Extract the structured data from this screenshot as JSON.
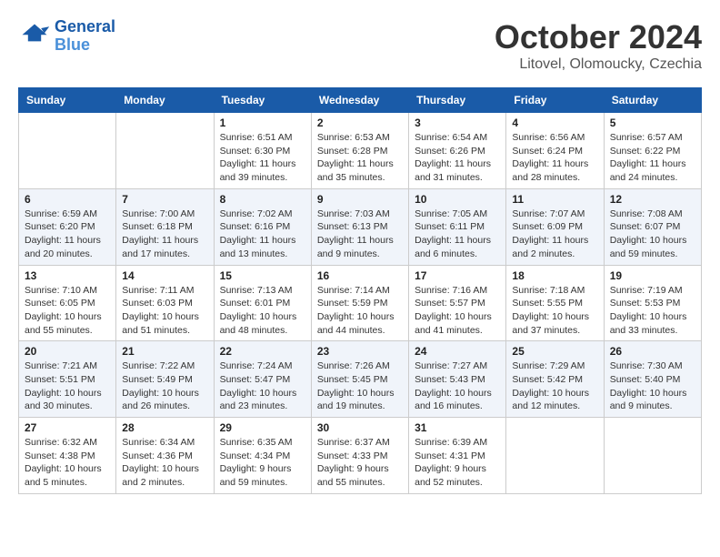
{
  "header": {
    "logo_line1": "General",
    "logo_line2": "Blue",
    "month_title": "October 2024",
    "subtitle": "Litovel, Olomoucky, Czechia"
  },
  "weekdays": [
    "Sunday",
    "Monday",
    "Tuesday",
    "Wednesday",
    "Thursday",
    "Friday",
    "Saturday"
  ],
  "weeks": [
    [
      {
        "day": "",
        "sunrise": "",
        "sunset": "",
        "daylight": ""
      },
      {
        "day": "",
        "sunrise": "",
        "sunset": "",
        "daylight": ""
      },
      {
        "day": "1",
        "sunrise": "Sunrise: 6:51 AM",
        "sunset": "Sunset: 6:30 PM",
        "daylight": "Daylight: 11 hours and 39 minutes."
      },
      {
        "day": "2",
        "sunrise": "Sunrise: 6:53 AM",
        "sunset": "Sunset: 6:28 PM",
        "daylight": "Daylight: 11 hours and 35 minutes."
      },
      {
        "day": "3",
        "sunrise": "Sunrise: 6:54 AM",
        "sunset": "Sunset: 6:26 PM",
        "daylight": "Daylight: 11 hours and 31 minutes."
      },
      {
        "day": "4",
        "sunrise": "Sunrise: 6:56 AM",
        "sunset": "Sunset: 6:24 PM",
        "daylight": "Daylight: 11 hours and 28 minutes."
      },
      {
        "day": "5",
        "sunrise": "Sunrise: 6:57 AM",
        "sunset": "Sunset: 6:22 PM",
        "daylight": "Daylight: 11 hours and 24 minutes."
      }
    ],
    [
      {
        "day": "6",
        "sunrise": "Sunrise: 6:59 AM",
        "sunset": "Sunset: 6:20 PM",
        "daylight": "Daylight: 11 hours and 20 minutes."
      },
      {
        "day": "7",
        "sunrise": "Sunrise: 7:00 AM",
        "sunset": "Sunset: 6:18 PM",
        "daylight": "Daylight: 11 hours and 17 minutes."
      },
      {
        "day": "8",
        "sunrise": "Sunrise: 7:02 AM",
        "sunset": "Sunset: 6:16 PM",
        "daylight": "Daylight: 11 hours and 13 minutes."
      },
      {
        "day": "9",
        "sunrise": "Sunrise: 7:03 AM",
        "sunset": "Sunset: 6:13 PM",
        "daylight": "Daylight: 11 hours and 9 minutes."
      },
      {
        "day": "10",
        "sunrise": "Sunrise: 7:05 AM",
        "sunset": "Sunset: 6:11 PM",
        "daylight": "Daylight: 11 hours and 6 minutes."
      },
      {
        "day": "11",
        "sunrise": "Sunrise: 7:07 AM",
        "sunset": "Sunset: 6:09 PM",
        "daylight": "Daylight: 11 hours and 2 minutes."
      },
      {
        "day": "12",
        "sunrise": "Sunrise: 7:08 AM",
        "sunset": "Sunset: 6:07 PM",
        "daylight": "Daylight: 10 hours and 59 minutes."
      }
    ],
    [
      {
        "day": "13",
        "sunrise": "Sunrise: 7:10 AM",
        "sunset": "Sunset: 6:05 PM",
        "daylight": "Daylight: 10 hours and 55 minutes."
      },
      {
        "day": "14",
        "sunrise": "Sunrise: 7:11 AM",
        "sunset": "Sunset: 6:03 PM",
        "daylight": "Daylight: 10 hours and 51 minutes."
      },
      {
        "day": "15",
        "sunrise": "Sunrise: 7:13 AM",
        "sunset": "Sunset: 6:01 PM",
        "daylight": "Daylight: 10 hours and 48 minutes."
      },
      {
        "day": "16",
        "sunrise": "Sunrise: 7:14 AM",
        "sunset": "Sunset: 5:59 PM",
        "daylight": "Daylight: 10 hours and 44 minutes."
      },
      {
        "day": "17",
        "sunrise": "Sunrise: 7:16 AM",
        "sunset": "Sunset: 5:57 PM",
        "daylight": "Daylight: 10 hours and 41 minutes."
      },
      {
        "day": "18",
        "sunrise": "Sunrise: 7:18 AM",
        "sunset": "Sunset: 5:55 PM",
        "daylight": "Daylight: 10 hours and 37 minutes."
      },
      {
        "day": "19",
        "sunrise": "Sunrise: 7:19 AM",
        "sunset": "Sunset: 5:53 PM",
        "daylight": "Daylight: 10 hours and 33 minutes."
      }
    ],
    [
      {
        "day": "20",
        "sunrise": "Sunrise: 7:21 AM",
        "sunset": "Sunset: 5:51 PM",
        "daylight": "Daylight: 10 hours and 30 minutes."
      },
      {
        "day": "21",
        "sunrise": "Sunrise: 7:22 AM",
        "sunset": "Sunset: 5:49 PM",
        "daylight": "Daylight: 10 hours and 26 minutes."
      },
      {
        "day": "22",
        "sunrise": "Sunrise: 7:24 AM",
        "sunset": "Sunset: 5:47 PM",
        "daylight": "Daylight: 10 hours and 23 minutes."
      },
      {
        "day": "23",
        "sunrise": "Sunrise: 7:26 AM",
        "sunset": "Sunset: 5:45 PM",
        "daylight": "Daylight: 10 hours and 19 minutes."
      },
      {
        "day": "24",
        "sunrise": "Sunrise: 7:27 AM",
        "sunset": "Sunset: 5:43 PM",
        "daylight": "Daylight: 10 hours and 16 minutes."
      },
      {
        "day": "25",
        "sunrise": "Sunrise: 7:29 AM",
        "sunset": "Sunset: 5:42 PM",
        "daylight": "Daylight: 10 hours and 12 minutes."
      },
      {
        "day": "26",
        "sunrise": "Sunrise: 7:30 AM",
        "sunset": "Sunset: 5:40 PM",
        "daylight": "Daylight: 10 hours and 9 minutes."
      }
    ],
    [
      {
        "day": "27",
        "sunrise": "Sunrise: 6:32 AM",
        "sunset": "Sunset: 4:38 PM",
        "daylight": "Daylight: 10 hours and 5 minutes."
      },
      {
        "day": "28",
        "sunrise": "Sunrise: 6:34 AM",
        "sunset": "Sunset: 4:36 PM",
        "daylight": "Daylight: 10 hours and 2 minutes."
      },
      {
        "day": "29",
        "sunrise": "Sunrise: 6:35 AM",
        "sunset": "Sunset: 4:34 PM",
        "daylight": "Daylight: 9 hours and 59 minutes."
      },
      {
        "day": "30",
        "sunrise": "Sunrise: 6:37 AM",
        "sunset": "Sunset: 4:33 PM",
        "daylight": "Daylight: 9 hours and 55 minutes."
      },
      {
        "day": "31",
        "sunrise": "Sunrise: 6:39 AM",
        "sunset": "Sunset: 4:31 PM",
        "daylight": "Daylight: 9 hours and 52 minutes."
      },
      {
        "day": "",
        "sunrise": "",
        "sunset": "",
        "daylight": ""
      },
      {
        "day": "",
        "sunrise": "",
        "sunset": "",
        "daylight": ""
      }
    ]
  ]
}
